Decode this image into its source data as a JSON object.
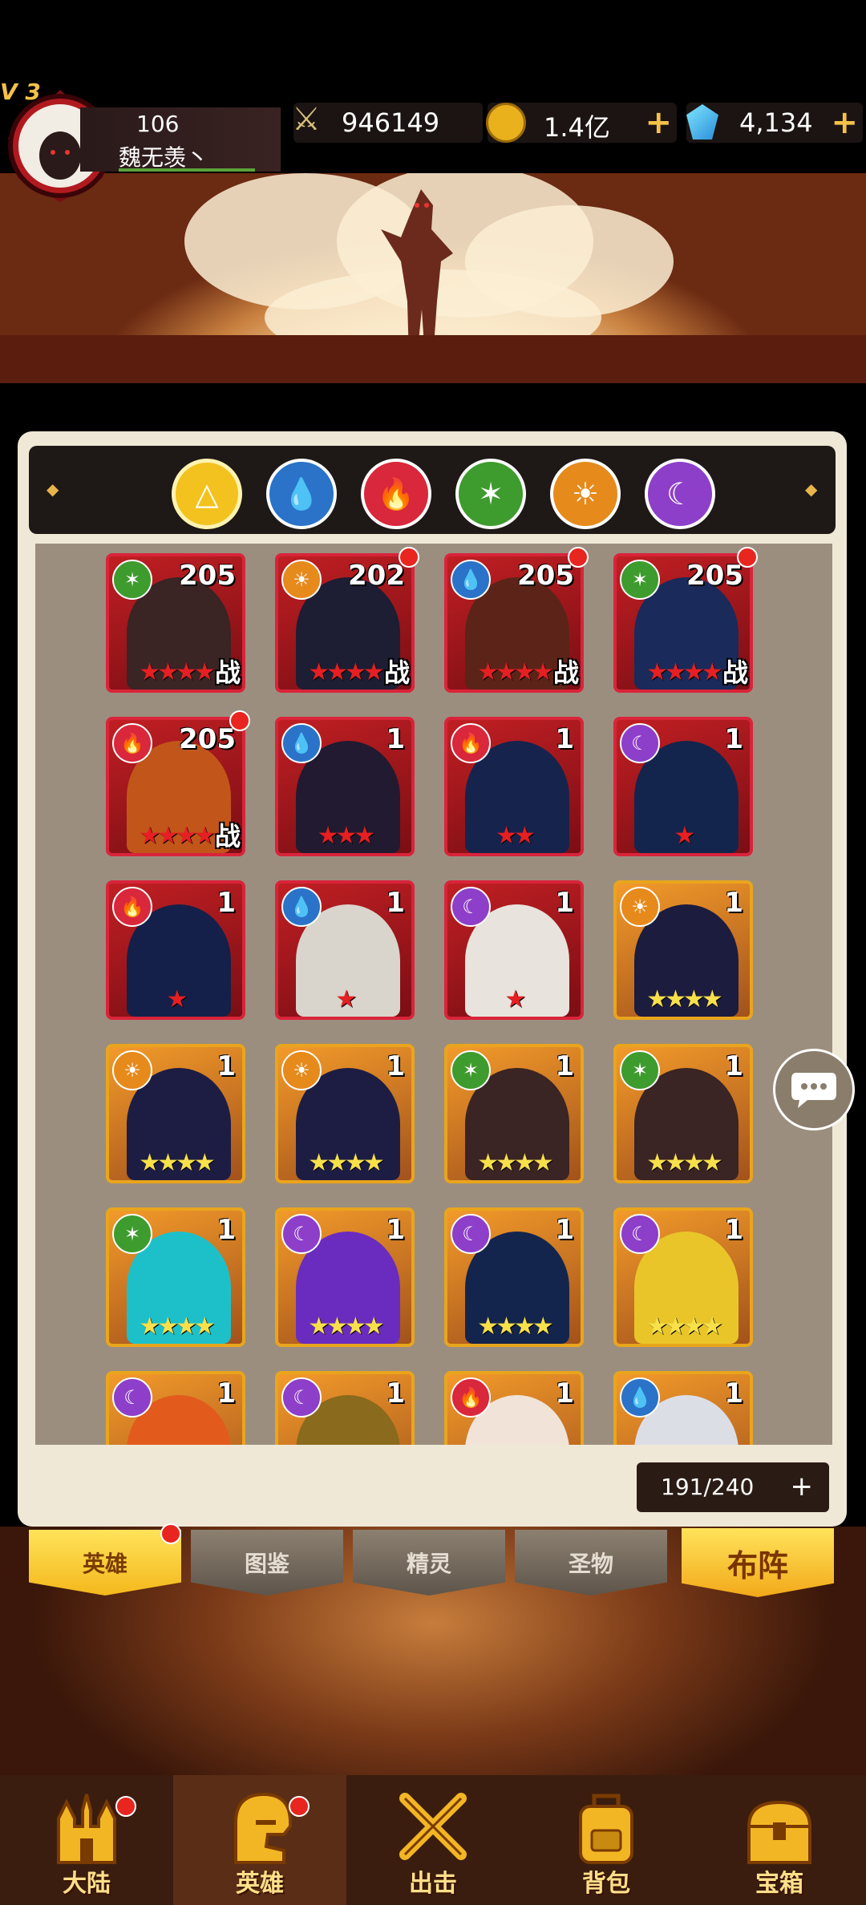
{
  "player": {
    "vip": "V 3",
    "level": "106",
    "name": "魏无羡丶"
  },
  "resources": {
    "power": "946149",
    "gold": "1.4亿",
    "gems": "4,134",
    "plus": "+"
  },
  "elements": [
    {
      "name": "all",
      "color": "#f3c21e",
      "glyph": "△"
    },
    {
      "name": "water",
      "color": "#2a73c9",
      "glyph": "💧"
    },
    {
      "name": "fire",
      "color": "#d9273b",
      "glyph": "🔥"
    },
    {
      "name": "wind",
      "color": "#3e9b2e",
      "glyph": "✶"
    },
    {
      "name": "sun",
      "color": "#e68a1c",
      "glyph": "☀"
    },
    {
      "name": "moon",
      "color": "#8d3fc9",
      "glyph": "☾"
    }
  ],
  "heroes": [
    {
      "level": "205",
      "frame": "red",
      "elem": "wind",
      "stars": "★★★★",
      "battle": "战",
      "dot": false,
      "art": "#3a2424"
    },
    {
      "level": "202",
      "frame": "red",
      "elem": "sun",
      "stars": "★★★★",
      "battle": "战",
      "dot": true,
      "art": "#1d1d33"
    },
    {
      "level": "205",
      "frame": "red",
      "elem": "water",
      "stars": "★★★★",
      "battle": "战",
      "dot": true,
      "art": "#5c2418"
    },
    {
      "level": "205",
      "frame": "red",
      "elem": "wind",
      "stars": "★★★★",
      "battle": "战",
      "dot": true,
      "art": "#1a2a5a"
    },
    {
      "level": "205",
      "frame": "red",
      "elem": "fire",
      "stars": "★★★★",
      "battle": "战",
      "dot": true,
      "art": "#c2561a"
    },
    {
      "level": "1",
      "frame": "red",
      "elem": "water",
      "stars": "★★★",
      "battle": "",
      "dot": false,
      "art": "#221a30"
    },
    {
      "level": "1",
      "frame": "red",
      "elem": "fire",
      "stars": "★★",
      "battle": "",
      "dot": false,
      "art": "#16234d"
    },
    {
      "level": "1",
      "frame": "red",
      "elem": "moon",
      "stars": "★",
      "battle": "",
      "dot": false,
      "art": "#14254d"
    },
    {
      "level": "1",
      "frame": "red",
      "elem": "fire",
      "stars": "★",
      "battle": "",
      "dot": false,
      "art": "#14204a"
    },
    {
      "level": "1",
      "frame": "red",
      "elem": "water",
      "stars": "★",
      "battle": "",
      "dot": false,
      "art": "#d9d4cc"
    },
    {
      "level": "1",
      "frame": "red",
      "elem": "moon",
      "stars": "★",
      "battle": "",
      "dot": false,
      "art": "#e8e3dc"
    },
    {
      "level": "1",
      "frame": "gold",
      "elem": "sun",
      "stars": "★★★★",
      "battle": "",
      "dot": false,
      "art": "#1c1c3e"
    },
    {
      "level": "1",
      "frame": "gold",
      "elem": "sun",
      "stars": "★★★★",
      "battle": "",
      "dot": false,
      "art": "#1d1d44"
    },
    {
      "level": "1",
      "frame": "gold",
      "elem": "sun",
      "stars": "★★★★",
      "battle": "",
      "dot": false,
      "art": "#1d1d44"
    },
    {
      "level": "1",
      "frame": "gold",
      "elem": "wind",
      "stars": "★★★★",
      "battle": "",
      "dot": false,
      "art": "#3a2424"
    },
    {
      "level": "1",
      "frame": "gold",
      "elem": "wind",
      "stars": "★★★★",
      "battle": "",
      "dot": false,
      "art": "#3a2424"
    },
    {
      "level": "1",
      "frame": "gold",
      "elem": "wind",
      "stars": "★★★★",
      "battle": "",
      "dot": false,
      "art": "#1dc0c9"
    },
    {
      "level": "1",
      "frame": "gold",
      "elem": "moon",
      "stars": "★★★★",
      "battle": "",
      "dot": false,
      "art": "#6a2cbf"
    },
    {
      "level": "1",
      "frame": "gold",
      "elem": "moon",
      "stars": "★★★★",
      "battle": "",
      "dot": false,
      "art": "#14254d"
    },
    {
      "level": "1",
      "frame": "gold",
      "elem": "moon",
      "stars": "★★★★",
      "battle": "",
      "dot": false,
      "art": "#e9c52a"
    },
    {
      "level": "1",
      "frame": "gold",
      "elem": "moon",
      "stars": "",
      "battle": "",
      "dot": false,
      "art": "#e25a1c"
    },
    {
      "level": "1",
      "frame": "gold",
      "elem": "moon",
      "stars": "",
      "battle": "",
      "dot": false,
      "art": "#8a6a1c"
    },
    {
      "level": "1",
      "frame": "gold",
      "elem": "fire",
      "stars": "",
      "battle": "",
      "dot": false,
      "art": "#f1e3d8"
    },
    {
      "level": "1",
      "frame": "gold",
      "elem": "water",
      "stars": "",
      "battle": "",
      "dot": false,
      "art": "#dcdee6"
    }
  ],
  "capacity": {
    "text": "191/240",
    "plus": "+"
  },
  "tabs": {
    "heroes": "英雄",
    "codex": "图鉴",
    "spirit": "精灵",
    "relic": "圣物",
    "formation": "布阵"
  },
  "nav": [
    {
      "label": "大陆",
      "icon": "castle-icon",
      "dot": true
    },
    {
      "label": "英雄",
      "icon": "helmet-icon",
      "dot": true
    },
    {
      "label": "出击",
      "icon": "crossed-swords-icon",
      "dot": false
    },
    {
      "label": "背包",
      "icon": "backpack-icon",
      "dot": false
    },
    {
      "label": "宝箱",
      "icon": "treasure-chest-icon",
      "dot": false
    }
  ]
}
